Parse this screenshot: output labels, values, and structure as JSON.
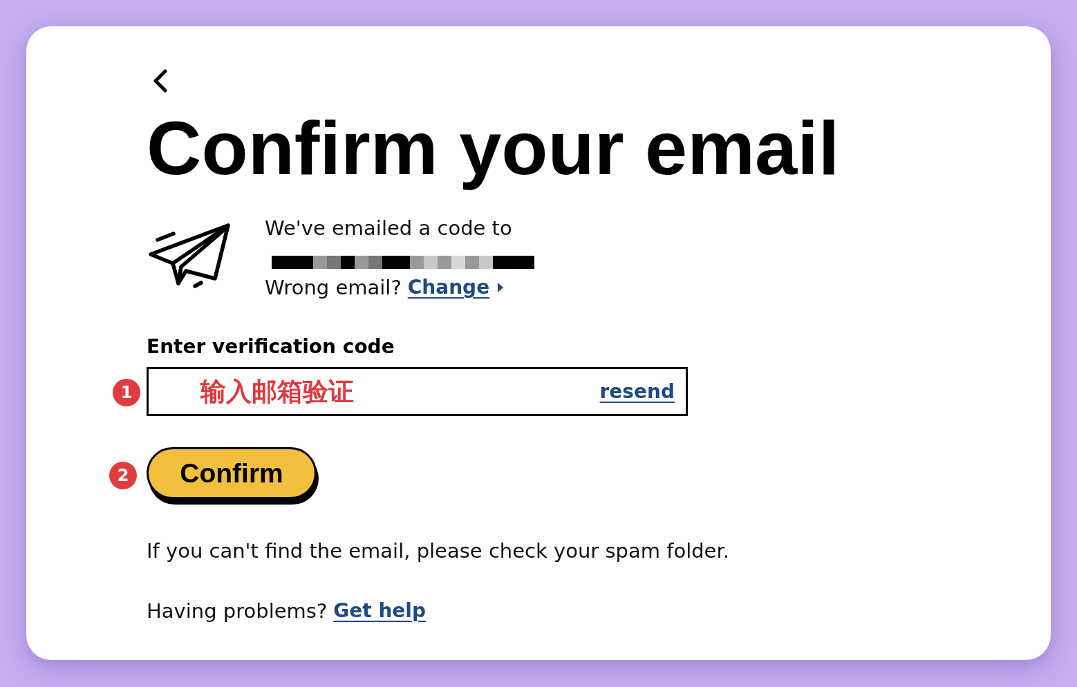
{
  "title": "Confirm your email",
  "sent_notice": {
    "text": "We've emailed a code to",
    "email_redacted": true,
    "wrong_email_text": "Wrong email?",
    "change_link": "Change"
  },
  "code_field": {
    "label": "Enter verification code",
    "marker": "1",
    "value": "输入邮箱验证",
    "resend_link": "resend"
  },
  "confirm_button": {
    "marker": "2",
    "label": "Confirm"
  },
  "spam_hint": "If you can't find the email, please check your spam folder.",
  "help": {
    "text": "Having problems?",
    "link": "Get help"
  }
}
